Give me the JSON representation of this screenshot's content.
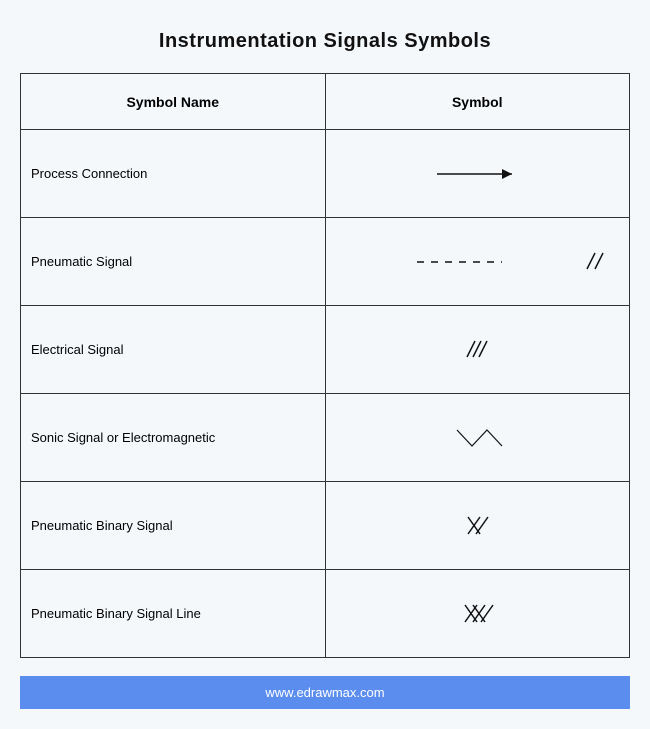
{
  "title": "Instrumentation Signals Symbols",
  "header": {
    "col1": "Symbol Name",
    "col2": "Symbol"
  },
  "rows": [
    {
      "name": "Process Connection",
      "symbol": "process-connection"
    },
    {
      "name": "Pneumatic Signal",
      "symbol": "pneumatic-signal"
    },
    {
      "name": "Electrical Signal",
      "symbol": "electrical-signal"
    },
    {
      "name": "Sonic Signal or Electromagnetic",
      "symbol": "sonic-electromagnetic"
    },
    {
      "name": "Pneumatic Binary Signal",
      "symbol": "pneumatic-binary"
    },
    {
      "name": "Pneumatic Binary Signal Line",
      "symbol": "pneumatic-binary-line"
    }
  ],
  "footer": "www.edrawmax.com",
  "colors": {
    "footer_bg": "#5b8def",
    "page_bg": "#f5f8fb",
    "stroke": "#111"
  }
}
